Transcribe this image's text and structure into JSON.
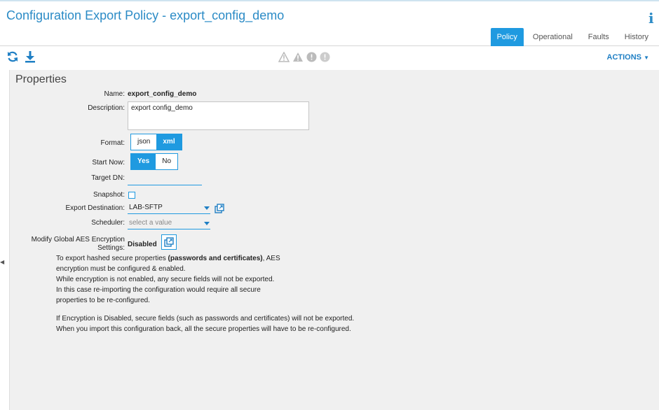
{
  "header": {
    "title": "Configuration Export Policy - export_config_demo",
    "info_label": "i"
  },
  "tabs": [
    {
      "label": "Policy",
      "active": true
    },
    {
      "label": "Operational",
      "active": false
    },
    {
      "label": "Faults",
      "active": false
    },
    {
      "label": "History",
      "active": false
    }
  ],
  "toolbar": {
    "refresh_icon": "refresh-icon",
    "download_icon": "download-icon",
    "actions_label": "ACTIONS",
    "fault_icons": [
      "critical-triangle-icon",
      "major-triangle-icon",
      "minor-circle-icon",
      "warning-circle-icon"
    ]
  },
  "properties": {
    "title": "Properties",
    "name_label": "Name:",
    "name_value": "export_config_demo",
    "description_label": "Description:",
    "description_value": "export config_demo",
    "format_label": "Format:",
    "format_options": [
      "json",
      "xml"
    ],
    "format_selected": "xml",
    "start_now_label": "Start Now:",
    "start_now_options": [
      "Yes",
      "No"
    ],
    "start_now_selected": "Yes",
    "target_dn_label": "Target DN:",
    "target_dn_value": "",
    "snapshot_label": "Snapshot:",
    "snapshot_checked": false,
    "export_destination_label": "Export Destination:",
    "export_destination_value": "LAB-SFTP",
    "scheduler_label": "Scheduler:",
    "scheduler_placeholder": "select a value",
    "aes_label_line1": "Modify Global AES Encryption",
    "aes_label_line2": "Settings:",
    "aes_value": "Disabled",
    "note1_pre": "To export hashed secure properties ",
    "note1_bold": "(passwords and certificates)",
    "note1_post": ", AES",
    "note1_line2": "encryption must be configured & enabled.",
    "note1_line3": "While encryption is not enabled, any secure fields will not be exported.",
    "note1_line4": "In this case re-importing the configuration would require all secure",
    "note1_line5": "properties to be re-configured.",
    "note2_line1": "If Encryption is Disabled, secure fields (such as passwords and certificates) will not be exported.",
    "note2_line2": "When you import this configuration back, all the secure properties will have to be re-configured."
  },
  "colors": {
    "accent": "#1f9ae0",
    "title_blue": "#2b8bc6"
  }
}
